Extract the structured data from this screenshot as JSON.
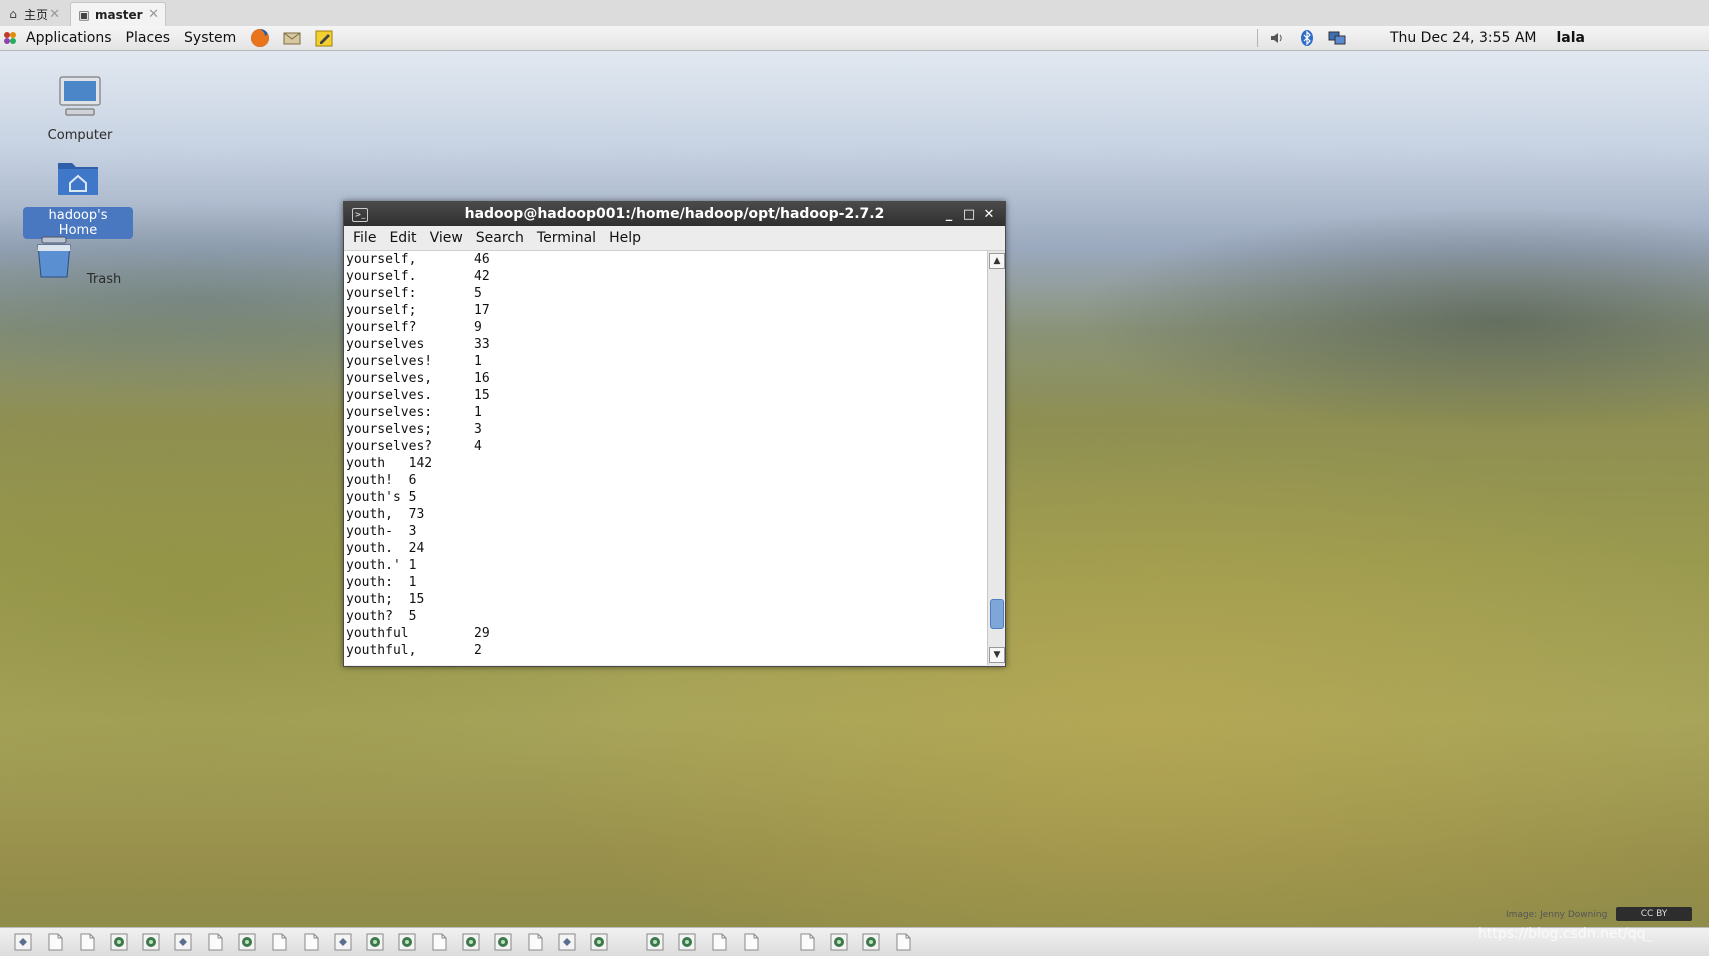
{
  "tabs": [
    {
      "label": "主页",
      "icon": "home-icon"
    },
    {
      "label": "master",
      "icon": "vm-icon"
    }
  ],
  "panel": {
    "menus": [
      "Applications",
      "Places",
      "System"
    ],
    "launchers": [
      "firefox-icon",
      "mail-icon",
      "notes-icon"
    ],
    "tray": [
      "volume-icon",
      "bluetooth-icon",
      "network-icon"
    ],
    "clock": "Thu Dec 24,  3:55 AM",
    "user": "lala"
  },
  "desktop": {
    "icons": [
      {
        "label": "Computer",
        "icon": "computer-icon",
        "selected": false
      },
      {
        "label": "hadoop's Home",
        "icon": "home-folder-icon",
        "selected": true
      },
      {
        "label": "Trash",
        "icon": "trash-icon",
        "selected": false
      }
    ]
  },
  "terminal": {
    "title": "hadoop@hadoop001:/home/hadoop/opt/hadoop-2.7.2",
    "menu": [
      "File",
      "Edit",
      "View",
      "Search",
      "Terminal",
      "Help"
    ],
    "lines": [
      {
        "word": "yourself,",
        "count": "46"
      },
      {
        "word": "yourself.",
        "count": "42"
      },
      {
        "word": "yourself:",
        "count": "5"
      },
      {
        "word": "yourself;",
        "count": "17"
      },
      {
        "word": "yourself?",
        "count": "9"
      },
      {
        "word": "yourselves",
        "count": "33"
      },
      {
        "word": "yourselves!",
        "count": "1"
      },
      {
        "word": "yourselves,",
        "count": "16"
      },
      {
        "word": "yourselves.",
        "count": "15"
      },
      {
        "word": "yourselves:",
        "count": "1"
      },
      {
        "word": "yourselves;",
        "count": "3"
      },
      {
        "word": "yourselves?",
        "count": "4"
      },
      {
        "text": "youth   142"
      },
      {
        "text": "youth!  6"
      },
      {
        "text": "youth's 5"
      },
      {
        "text": "youth,  73"
      },
      {
        "text": "youth-  3"
      },
      {
        "text": "youth.  24"
      },
      {
        "text": "youth.' 1"
      },
      {
        "text": "youth:  1"
      },
      {
        "text": "youth;  15"
      },
      {
        "text": "youth?  5"
      },
      {
        "word": "youthful",
        "count": "29"
      },
      {
        "word": "youthful,",
        "count": "2"
      }
    ]
  },
  "wallpaper": {
    "credit": "Image: Jenny Downing",
    "license": "CC BY"
  },
  "watermark": "https://blog.csdn.net/qq_"
}
